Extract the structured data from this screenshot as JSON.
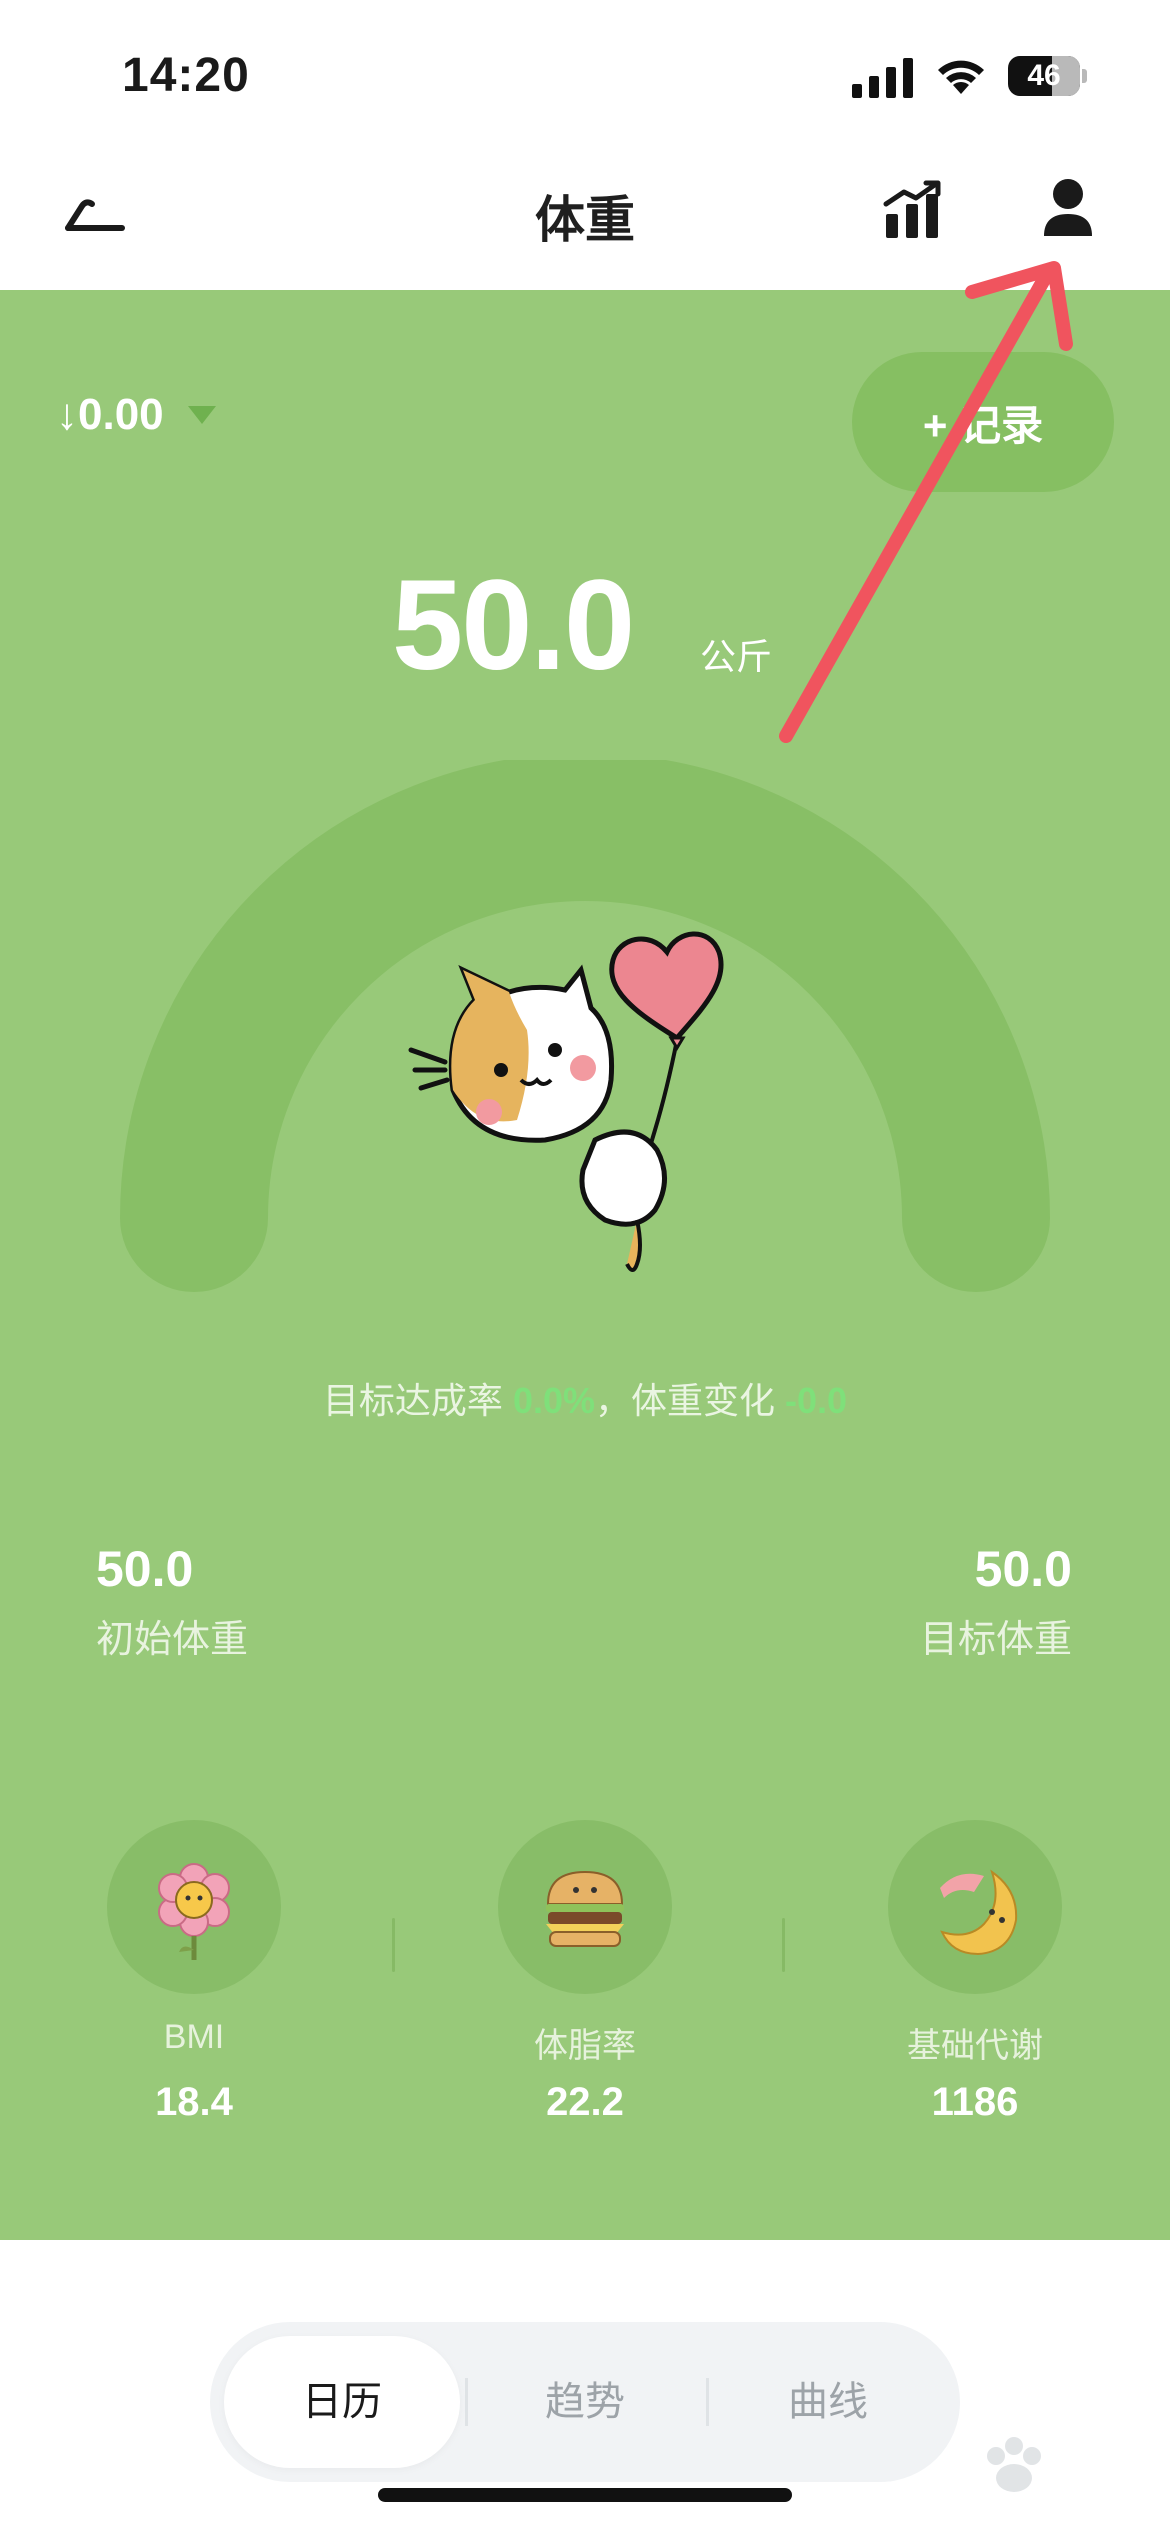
{
  "status_bar": {
    "time": "14:20",
    "battery": "46"
  },
  "nav": {
    "title": "体重"
  },
  "hero": {
    "change": "↓0.00",
    "record_button": "+ 记录",
    "current_weight": "50.0",
    "unit": "公斤",
    "goal_summary": {
      "prefix": "目标达成率 ",
      "rate": "0.0%",
      "middle": "，体重变化 ",
      "change": "-0.0"
    },
    "initial": {
      "value": "50.0",
      "label": "初始体重"
    },
    "target": {
      "value": "50.0",
      "label": "目标体重"
    },
    "metrics": [
      {
        "icon": "flower-icon",
        "label": "BMI",
        "value": "18.4"
      },
      {
        "icon": "burger-icon",
        "label": "体脂率",
        "value": "22.2"
      },
      {
        "icon": "moon-icon",
        "label": "基础代谢",
        "value": "1186"
      }
    ]
  },
  "tabs": [
    {
      "label": "日历",
      "active": true
    },
    {
      "label": "趋势",
      "active": false
    },
    {
      "label": "曲线",
      "active": false
    }
  ],
  "colors": {
    "hero_bg": "#98c979",
    "accent_green": "#7fe07a",
    "annotation_red": "#f0545e"
  }
}
